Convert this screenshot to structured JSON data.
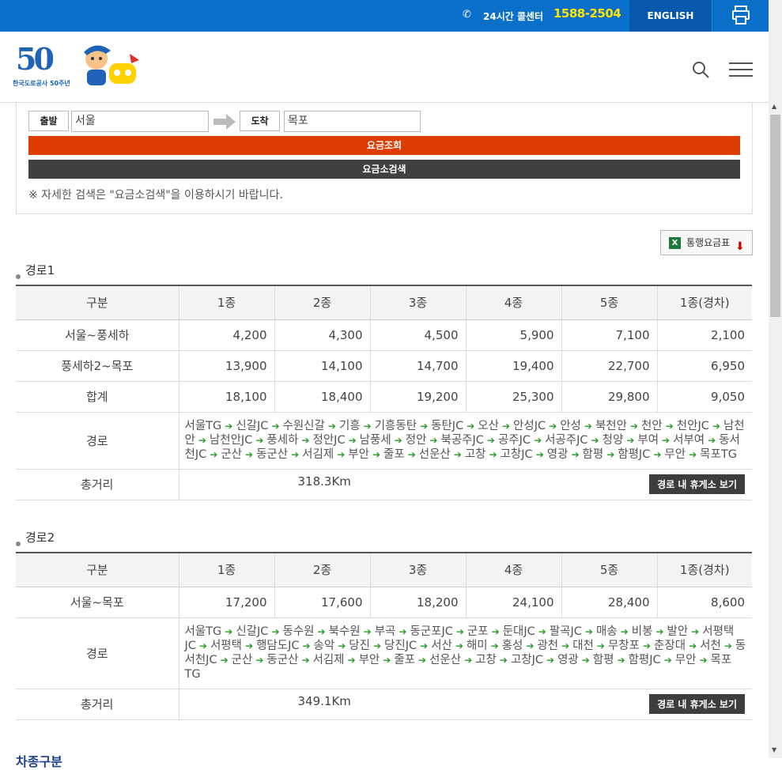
{
  "topbar": {
    "call_center_label": "24시간 콜센터",
    "call_center_number": "1588-2504",
    "english_label": "ENGLISH"
  },
  "logo": {
    "number": "50",
    "subtitle": "한국도로공사 50주년"
  },
  "search": {
    "origin_label": "출발",
    "origin_value": "서울",
    "dest_label": "도착",
    "dest_value": "목포",
    "fare_button": "요금조회",
    "tollgate_button": "요금소검색",
    "note": "※ 자세한 검색은 \"요금소검색\"을 이용하시기 바랍니다."
  },
  "excel_button": "통행요금표",
  "columns": [
    "구분",
    "1종",
    "2종",
    "3종",
    "4종",
    "5종",
    "1종(경차)"
  ],
  "routes": [
    {
      "title": "경로1",
      "rows": [
        {
          "label": "서울~풍세하",
          "values": [
            "4,200",
            "4,300",
            "4,500",
            "5,900",
            "7,100",
            "2,100"
          ]
        },
        {
          "label": "풍세하2~목포",
          "values": [
            "13,900",
            "14,100",
            "14,700",
            "19,400",
            "22,700",
            "6,950"
          ]
        },
        {
          "label": "합계",
          "values": [
            "18,100",
            "18,400",
            "19,200",
            "25,300",
            "29,800",
            "9,050"
          ]
        }
      ],
      "path_label": "경로",
      "path": [
        "서울TG",
        "신갈JC",
        "수원신갈",
        "기흥",
        "기흥동탄",
        "동탄JC",
        "오산",
        "안성JC",
        "안성",
        "북천안",
        "천안",
        "천안JC",
        "남천안",
        "남천안JC",
        "풍세하",
        "정안JC",
        "남풍세",
        "정안",
        "북공주JC",
        "공주JC",
        "서공주JC",
        "청양",
        "부여",
        "서부여",
        "동서천JC",
        "군산",
        "동군산",
        "서김제",
        "부안",
        "줄포",
        "선운산",
        "고창",
        "고창JC",
        "영광",
        "함평",
        "함평JC",
        "무안",
        "목포TG"
      ],
      "distance_label": "총거리",
      "distance": "318.3Km",
      "rest_button": "경로 내 휴게소 보기"
    },
    {
      "title": "경로2",
      "rows": [
        {
          "label": "서울~목포",
          "values": [
            "17,200",
            "17,600",
            "18,200",
            "24,100",
            "28,400",
            "8,600"
          ]
        }
      ],
      "path_label": "경로",
      "path": [
        "서울TG",
        "신갈JC",
        "동수원",
        "북수원",
        "부곡",
        "동군포JC",
        "군포",
        "둔대JC",
        "팔곡JC",
        "매송",
        "비봉",
        "발안",
        "서평택JC",
        "서평택",
        "행담도JC",
        "송악",
        "당진",
        "당진JC",
        "서산",
        "해미",
        "홍성",
        "광천",
        "대천",
        "무창포",
        "춘장대",
        "서천",
        "동서천JC",
        "군산",
        "동군산",
        "서김제",
        "부안",
        "줄포",
        "선운산",
        "고창",
        "고창JC",
        "영광",
        "함평",
        "함평JC",
        "무안",
        "목포TG"
      ],
      "distance_label": "총거리",
      "distance": "349.1Km",
      "rest_button": "경로 내 휴게소 보기"
    }
  ],
  "footer_partial": "차종구분",
  "colors": {
    "topbar": "#0a6fc9",
    "accent_yellow": "#ffe400",
    "fare_button": "#de3b00",
    "arrow": "#2a9a2a"
  }
}
